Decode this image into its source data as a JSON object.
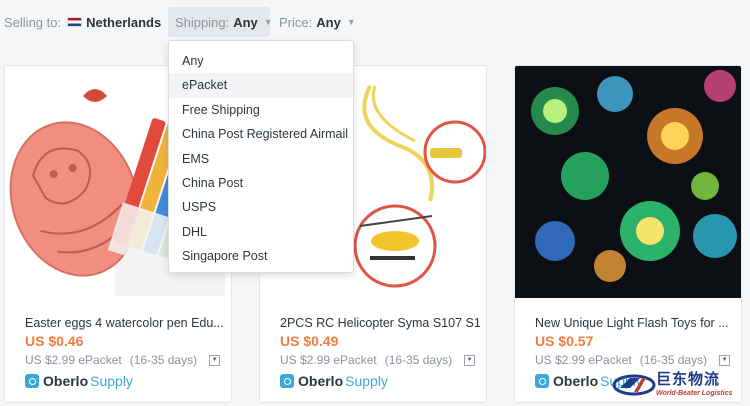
{
  "filters": {
    "selling_label": "Selling to:",
    "selling_value": "Netherlands",
    "shipping_label": "Shipping:",
    "shipping_value": "Any",
    "price_label": "Price:",
    "price_value": "Any"
  },
  "shipping_dropdown": {
    "options": [
      "Any",
      "ePacket",
      "Free Shipping",
      "China Post Registered Airmail",
      "EMS",
      "China Post",
      "USPS",
      "DHL",
      "Singapore Post"
    ],
    "highlighted": "ePacket"
  },
  "products": [
    {
      "title": "Easter eggs 4 watercolor pen Edu...",
      "price": "US $0.46",
      "shipping_cost": "US $2.99 ePacket",
      "shipping_days": "(16-35 days)",
      "brand": "Oberlo",
      "brand_sub": "Supply"
    },
    {
      "title": "2PCS RC Helicopter Syma S107 S1...",
      "price": "US $0.49",
      "shipping_cost": "US $2.99 ePacket",
      "shipping_days": "(16-35 days)",
      "brand": "Oberlo",
      "brand_sub": "Supply"
    },
    {
      "title": "New Unique Light Flash Toys for ...",
      "price": "US $0.57",
      "shipping_cost": "US $2.99 ePacket",
      "shipping_days": "(16-35 days)",
      "brand": "Oberlo",
      "brand_sub": "Supply"
    }
  ],
  "watermark": {
    "cn": "巨东物流",
    "en": "World-Beater Logistics"
  },
  "icons": {
    "flag": "netherlands-flag-icon",
    "chevron": "chevron-down-icon",
    "brand": "oberlo-logo-icon"
  },
  "colors": {
    "price": "#f07c3d",
    "brand": "#3aa8d8",
    "text": "#2d3540"
  }
}
